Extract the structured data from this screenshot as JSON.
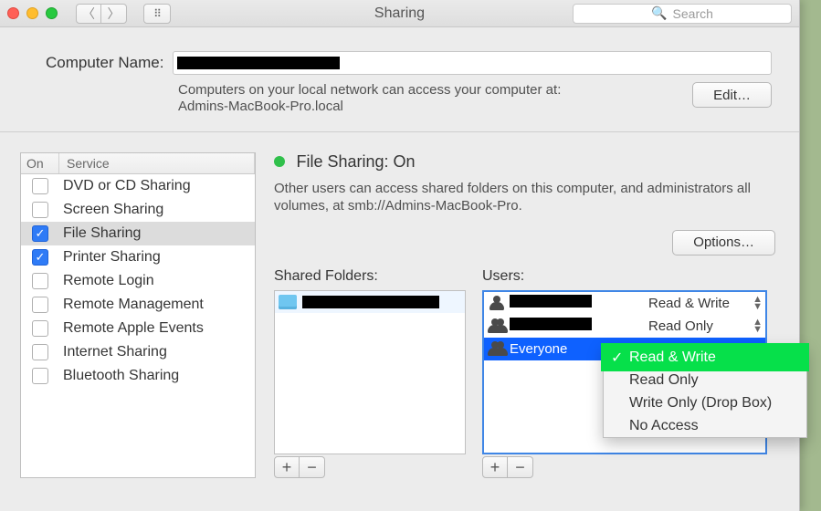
{
  "titlebar": {
    "title": "Sharing",
    "search_placeholder": "Search"
  },
  "top": {
    "computer_name_label": "Computer Name:",
    "computer_name_value": "████████████████",
    "help_line1": "Computers on your local network can access your computer at:",
    "help_line2": "Admins-MacBook-Pro.local",
    "edit_label": "Edit…"
  },
  "services_header": {
    "on": "On",
    "service": "Service"
  },
  "services": [
    {
      "on": false,
      "label": "DVD or CD Sharing",
      "selected": false
    },
    {
      "on": false,
      "label": "Screen Sharing",
      "selected": false
    },
    {
      "on": true,
      "label": "File Sharing",
      "selected": true
    },
    {
      "on": true,
      "label": "Printer Sharing",
      "selected": false
    },
    {
      "on": false,
      "label": "Remote Login",
      "selected": false
    },
    {
      "on": false,
      "label": "Remote Management",
      "selected": false
    },
    {
      "on": false,
      "label": "Remote Apple Events",
      "selected": false
    },
    {
      "on": false,
      "label": "Internet Sharing",
      "selected": false
    },
    {
      "on": false,
      "label": "Bluetooth Sharing",
      "selected": false
    }
  ],
  "right": {
    "status_title": "File Sharing: On",
    "status_desc": "Other users can access shared folders on this computer, and administrators all volumes, at smb://Admins-MacBook-Pro.",
    "options_label": "Options…",
    "shared_folders_label": "Shared Folders:",
    "users_label": "Users:"
  },
  "folders": [
    {
      "name": "██████████████"
    }
  ],
  "users": [
    {
      "name": "████████",
      "perm": "Read & Write",
      "selected": false,
      "single": true
    },
    {
      "name": "███████",
      "perm": "Read Only",
      "selected": false,
      "single": false
    },
    {
      "name": "Everyone",
      "perm": "",
      "selected": true,
      "single": false
    }
  ],
  "buttons": {
    "plus": "+",
    "minus": "−"
  },
  "popup": {
    "items": [
      {
        "label": "Read & Write",
        "checked": true,
        "selected": true
      },
      {
        "label": "Read Only",
        "checked": false,
        "selected": false
      },
      {
        "label": "Write Only (Drop Box)",
        "checked": false,
        "selected": false
      },
      {
        "label": "No Access",
        "checked": false,
        "selected": false
      }
    ]
  }
}
